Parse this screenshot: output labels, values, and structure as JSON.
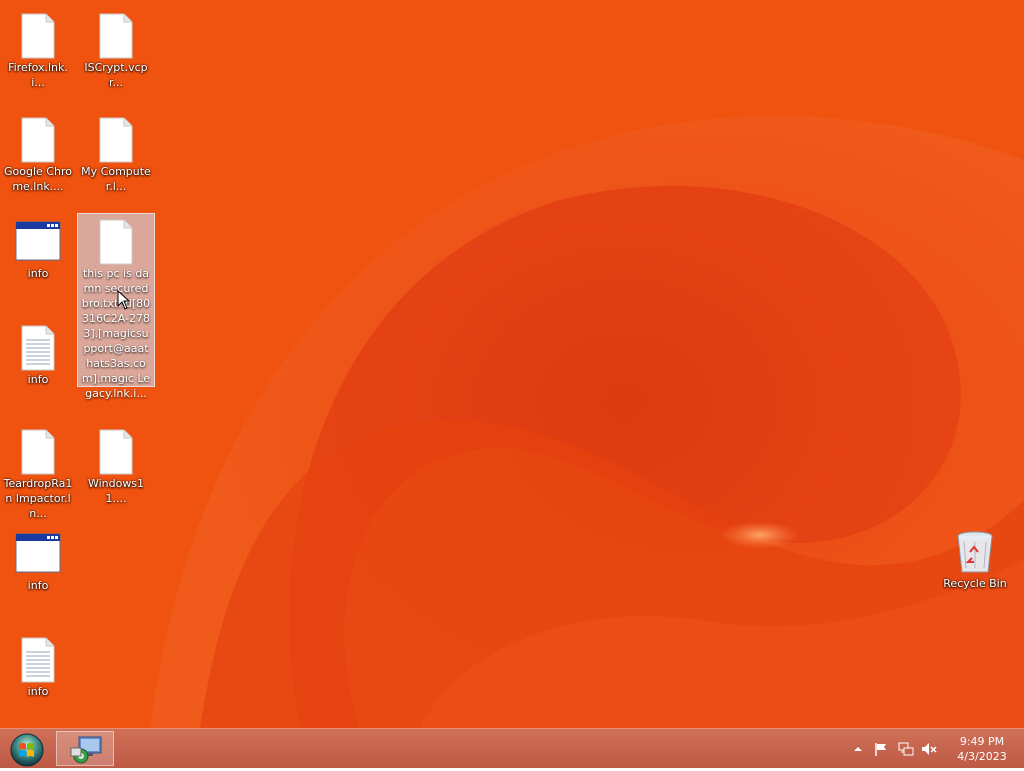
{
  "desktop": {
    "icons": [
      {
        "label": "Firefox.lnk.i...",
        "type": "file"
      },
      {
        "label": "ISCrypt.vcpr...",
        "type": "file"
      },
      {
        "label": "Google Chrome.lnk....",
        "type": "file"
      },
      {
        "label": "My Computer.l...",
        "type": "file"
      },
      {
        "label": "info",
        "type": "window"
      },
      {
        "label": "this pc is damn secured bro.txt.id[80316C2A-2783].[magicsupport@aaathats3as.com].magic Legacy.lnk.i...",
        "type": "file",
        "selected": true
      },
      {
        "label": "info",
        "type": "text-document"
      },
      {
        "label": "TeardropRa1n Impactor.ln...",
        "type": "file"
      },
      {
        "label": "Windows11....",
        "type": "file"
      },
      {
        "label": "info",
        "type": "window"
      },
      {
        "label": "info",
        "type": "text-document"
      },
      {
        "label": "Recycle Bin",
        "type": "recycle-bin"
      }
    ]
  },
  "taskbar": {
    "start_icon": "windows-orb-icon",
    "pinned_app_icon": "control-panel-icon",
    "tray_icons": [
      "show-hidden-icons-arrow-icon",
      "action-center-flag-icon",
      "network-icon",
      "volume-muted-icon"
    ],
    "clock": {
      "time": "9:49 PM",
      "date": "4/3/2023"
    }
  }
}
